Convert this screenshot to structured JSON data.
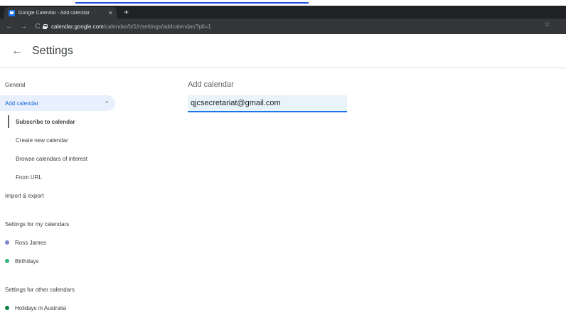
{
  "browser": {
    "tab_title": "Google Calendar - Add calendar",
    "tab_close": "×",
    "new_tab": "+",
    "url_host": "calendar.google.com",
    "url_path": "/calendar/b/1/r/settings/addcalendar/?pli=1",
    "back": "←",
    "forward": "→",
    "reload": "C",
    "star": "☆"
  },
  "header": {
    "back_arrow": "←",
    "title": "Settings"
  },
  "sidebar": {
    "general": "General",
    "add_calendar": "Add calendar",
    "add_calendar_chevron": "^",
    "sub_items": [
      "Subscribe to calendar",
      "Create new calendar",
      "Browse calendars of interest",
      "From URL"
    ],
    "import_export": "Import & export",
    "my_calendars_heading": "Settings for my calendars",
    "my_calendars": [
      {
        "label": "Ross James",
        "color": "#7986cb"
      },
      {
        "label": "Birthdays",
        "color": "#33b679"
      }
    ],
    "other_calendars_heading": "Settings for other calendars",
    "other_calendars": [
      {
        "label": "Holidays in Australia",
        "color": "#0b8043"
      }
    ]
  },
  "main": {
    "heading": "Add calendar",
    "email_value": "qjcsecretariat@gmail.com"
  }
}
